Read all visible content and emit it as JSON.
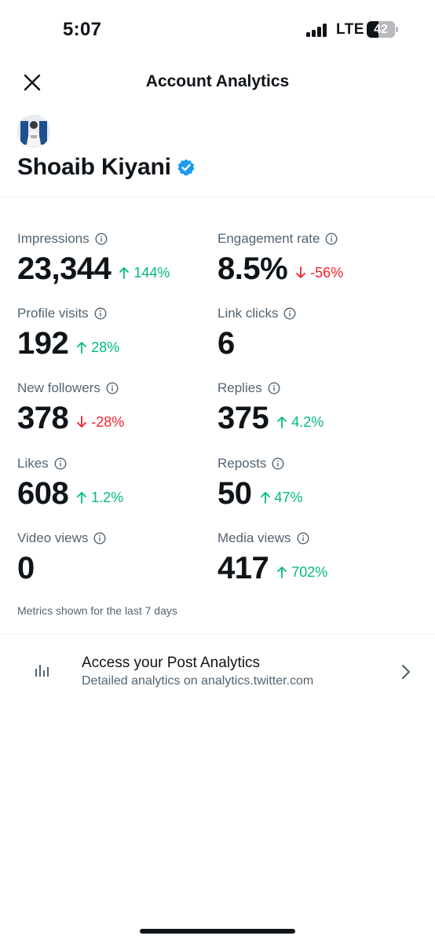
{
  "status_bar": {
    "time": "5:07",
    "network": "LTE",
    "battery_percent": "42",
    "battery_level": 0.42,
    "signal_bars": 4
  },
  "nav": {
    "close_icon": "close-icon",
    "title": "Account Analytics"
  },
  "profile": {
    "name": "Shoaib Kiyani",
    "verified_icon": "verified-badge-icon",
    "verified_color": "#1d9bf0"
  },
  "metrics": [
    {
      "label": "Impressions",
      "value": "23,344",
      "change": "144%",
      "direction": "up"
    },
    {
      "label": "Engagement rate",
      "value": "8.5%",
      "change": "-56%",
      "direction": "down"
    },
    {
      "label": "Profile visits",
      "value": "192",
      "change": "28%",
      "direction": "up"
    },
    {
      "label": "Link clicks",
      "value": "6",
      "change": "",
      "direction": "none"
    },
    {
      "label": "New followers",
      "value": "378",
      "change": "-28%",
      "direction": "down"
    },
    {
      "label": "Replies",
      "value": "375",
      "change": "4.2%",
      "direction": "up"
    },
    {
      "label": "Likes",
      "value": "608",
      "change": "1.2%",
      "direction": "up"
    },
    {
      "label": "Reposts",
      "value": "50",
      "change": "47%",
      "direction": "up"
    },
    {
      "label": "Video views",
      "value": "0",
      "change": "",
      "direction": "none"
    },
    {
      "label": "Media views",
      "value": "417",
      "change": "702%",
      "direction": "up"
    }
  ],
  "metrics_note": "Metrics shown for the last 7 days",
  "post_analytics": {
    "icon": "bar-chart-icon",
    "title": "Access your Post Analytics",
    "subtitle": "Detailed analytics on analytics.twitter.com",
    "chevron_icon": "chevron-right-icon"
  },
  "colors": {
    "positive": "#00ba7c",
    "negative": "#f4212e",
    "secondary_text": "#536471",
    "primary_text": "#0f1419"
  }
}
